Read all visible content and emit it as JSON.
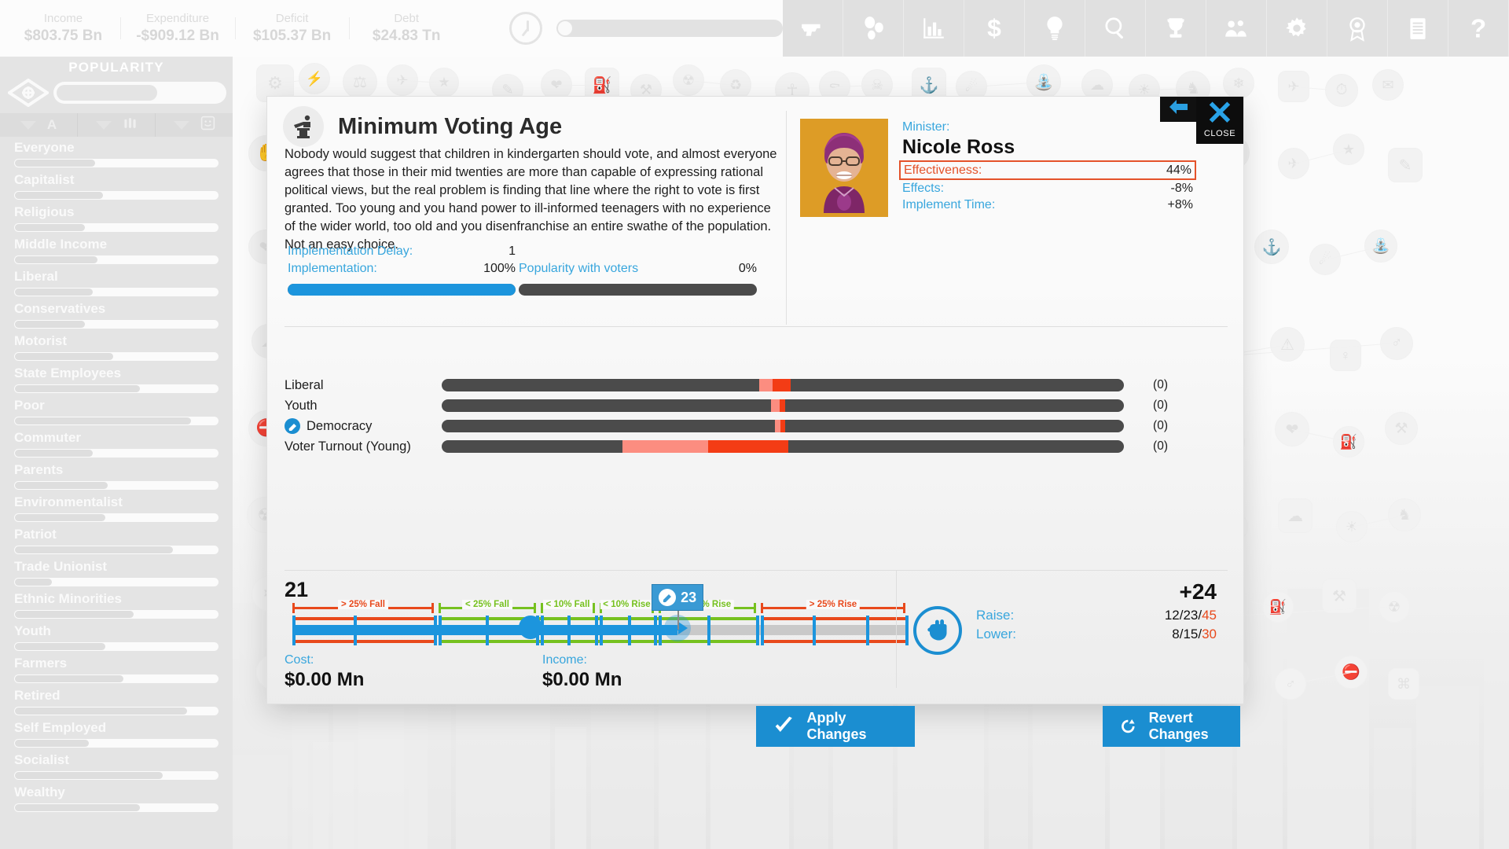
{
  "topbar": {
    "stats": [
      {
        "label": "Income",
        "value": "$803.75 Bn"
      },
      {
        "label": "Expenditure",
        "value": "-$909.12 Bn"
      },
      {
        "label": "Deficit",
        "value": "$105.37 Bn"
      },
      {
        "label": "Debt",
        "value": "$24.83 Tn"
      }
    ],
    "clock_icon": "clock-icon",
    "speed_slider_name": "game-speed-slider",
    "tool_icons": [
      "pistol-icon",
      "policies-icon",
      "bar-chart-icon",
      "dollar-icon",
      "lightbulb-icon",
      "search-icon",
      "trophy-icon",
      "people-group-icon",
      "gear-icon",
      "medal-icon",
      "document-icon",
      "question-mark-icon"
    ]
  },
  "sidebar": {
    "title": "POPULARITY",
    "eye_icon": "eye-icon",
    "filter_icons": [
      "chevron-down-icon",
      "alphabetical-sort-icon",
      "chevron-down-icon",
      "population-icon",
      "chevron-down-icon",
      "smiley-icon"
    ],
    "groups": [
      {
        "name": "Everyone",
        "value": 40
      },
      {
        "name": "Capitalist",
        "value": 44
      },
      {
        "name": "Religious",
        "value": 35
      },
      {
        "name": "Middle Income",
        "value": 41
      },
      {
        "name": "Liberal",
        "value": 39
      },
      {
        "name": "Conservatives",
        "value": 35
      },
      {
        "name": "Motorist",
        "value": 49
      },
      {
        "name": "State Employees",
        "value": 62
      },
      {
        "name": "Poor",
        "value": 87
      },
      {
        "name": "Commuter",
        "value": 39
      },
      {
        "name": "Parents",
        "value": 46
      },
      {
        "name": "Environmentalist",
        "value": 45
      },
      {
        "name": "Patriot",
        "value": 78
      },
      {
        "name": "Trade Unionist",
        "value": 19
      },
      {
        "name": "Ethnic Minorities",
        "value": 59
      },
      {
        "name": "Youth",
        "value": 45
      },
      {
        "name": "Farmers",
        "value": 54
      },
      {
        "name": "Retired",
        "value": 85
      },
      {
        "name": "Self Employed",
        "value": 37
      },
      {
        "name": "Socialist",
        "value": 73
      },
      {
        "name": "Wealthy",
        "value": 62
      }
    ]
  },
  "dialog": {
    "icon": "voting-podium-icon",
    "title": "Minimum Voting Age",
    "description": "Nobody would suggest that children in kindergarten should vote, and almost everyone agrees that those in their mid twenties are more than capable of expressing rational political views, but the real problem is finding that line where the right to vote is first granted. Too young and you hand power to ill-informed teenagers with no experience of the wider world, too old and you disenfranchise an entire swathe of the population. Not an easy choice.",
    "back_icon": "back-arrow-icon",
    "close": {
      "icon": "close-x-icon",
      "label": "CLOSE"
    },
    "minister": {
      "label": "Minister:",
      "name": "Nicole Ross",
      "effectiveness_label": "Effectiveness:",
      "effectiveness_value": "44%",
      "effects_label": "Effects:",
      "effects_value": "-8%",
      "implement_time_label": "Implement Time:",
      "implement_time_value": "+8%"
    },
    "implementation": {
      "delay_label": "Implementation Delay:",
      "delay_value": "1",
      "impl_label": "Implementation:",
      "impl_value": "100%",
      "impl_percent": 100,
      "popularity_label": "Popularity with voters",
      "popularity_value": "0%",
      "popularity_percent": 0
    },
    "effects": [
      {
        "name": "Liberal",
        "icon": null,
        "value": "(0)",
        "light_start": 46.5,
        "light_width": 2.0,
        "solid_start": 48.5,
        "solid_width": 2.7
      },
      {
        "name": "Youth",
        "icon": null,
        "value": "(0)",
        "light_start": 48.3,
        "light_width": 1.2,
        "solid_start": 49.5,
        "solid_width": 0.8
      },
      {
        "name": "Democracy",
        "icon": "democracy-icon",
        "value": "(0)",
        "light_start": 48.8,
        "light_width": 0.8,
        "solid_start": 49.6,
        "solid_width": 0.7
      },
      {
        "name": "Voter Turnout (Young)",
        "icon": null,
        "value": "(0)",
        "light_start": 26.5,
        "light_width": 12.5,
        "solid_start": 39.0,
        "solid_width": 11.8
      }
    ],
    "policy_slider": {
      "current_value": "21",
      "new_value": "23",
      "new_value_icon": "democracy-icon",
      "current_pos": 41.2,
      "new_pos": 65.8,
      "bands": [
        {
          "label": "> 25% Fall",
          "color": "red",
          "start": 0.0,
          "end": 25.5
        },
        {
          "label": "< 25% Fall",
          "color": "green",
          "start": 26.5,
          "end": 52.0
        },
        {
          "label": "< 10% Fall",
          "color": "green",
          "start": 26.5,
          "end": 52.0
        },
        {
          "label": "< 10% Rise",
          "color": "green",
          "start": 26.5,
          "end": 52.0
        },
        {
          "label": "< 25% Rise",
          "color": "green",
          "start": 26.5,
          "end": 52.0
        },
        {
          "label": "> 25% Rise",
          "color": "red",
          "start": 67.0,
          "end": 100.0
        }
      ]
    },
    "cost": {
      "label": "Cost:",
      "value": "$0.00 Mn"
    },
    "income": {
      "label": "Income:",
      "value": "$0.00 Mn"
    },
    "right_info": {
      "icon": "fist-icon",
      "total": "+24",
      "raise_label": "Raise:",
      "raise_value_a": "12/23/",
      "raise_value_b": "45",
      "lower_label": "Lower:",
      "lower_value_a": "8/15/",
      "lower_value_b": "30"
    }
  },
  "actions": {
    "apply": {
      "label": "Apply Changes",
      "icon": "checkmark-icon"
    },
    "revert": {
      "label": "Revert Changes",
      "icon": "refresh-icon"
    }
  },
  "colors": {
    "accent_blue": "#1b8ed1",
    "link_blue": "#38a6dd",
    "red": "#e8491c",
    "green": "#76c11f",
    "orange_portrait": "#dd9c26"
  }
}
